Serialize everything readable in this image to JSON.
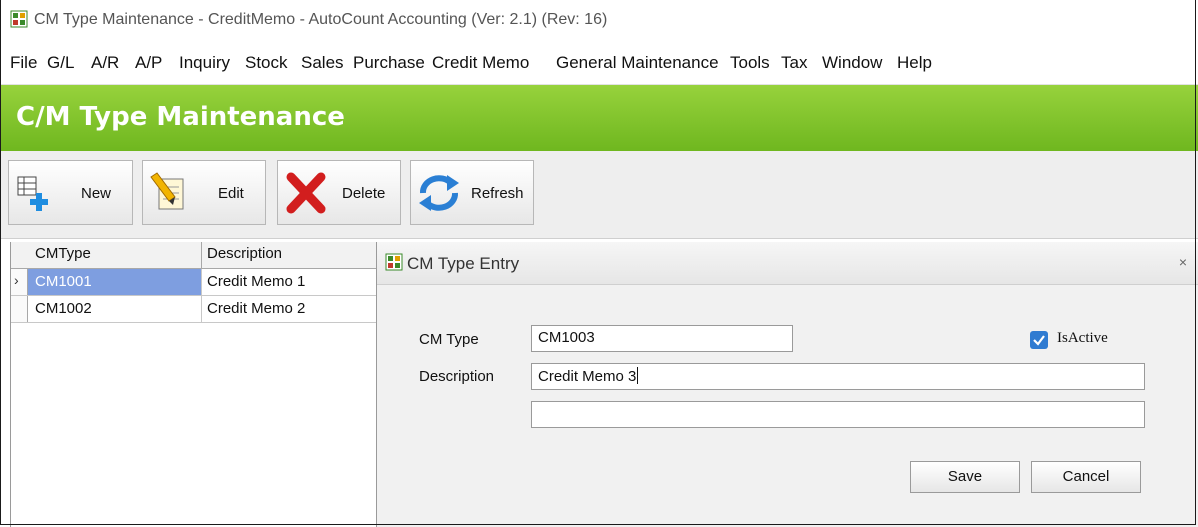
{
  "window": {
    "title": "CM Type Maintenance - CreditMemo - AutoCount Accounting (Ver: 2.1) (Rev: 16)"
  },
  "menu": [
    "File",
    "G/L",
    "A/R",
    "A/P",
    "Inquiry",
    "Stock",
    "Sales",
    "Purchase",
    "Credit Memo",
    "General Maintenance",
    "Tools",
    "Tax",
    "Window",
    "Help"
  ],
  "banner": {
    "title": "C/M Type Maintenance"
  },
  "toolbar": {
    "new_label": "New",
    "edit_label": "Edit",
    "delete_label": "Delete",
    "refresh_label": "Refresh"
  },
  "grid": {
    "columns": [
      "CMType",
      "Description"
    ],
    "rows": [
      {
        "cmtype": "CM1001",
        "description": "Credit Memo 1"
      },
      {
        "cmtype": "CM1002",
        "description": "Credit Memo 2"
      }
    ]
  },
  "dialog": {
    "title": "CM Type Entry",
    "close_glyph": "×",
    "cm_type_label": "CM Type",
    "cm_type_value": "CM1003",
    "is_active_label": "IsActive",
    "is_active_checked": true,
    "description_label": "Description",
    "description_value": "Credit Memo 3",
    "description2_value": "",
    "save_label": "Save",
    "cancel_label": "Cancel"
  },
  "colors": {
    "banner": "#7cc22a",
    "selection": "#7e9ee0",
    "checkbox": "#2f7bd1"
  }
}
